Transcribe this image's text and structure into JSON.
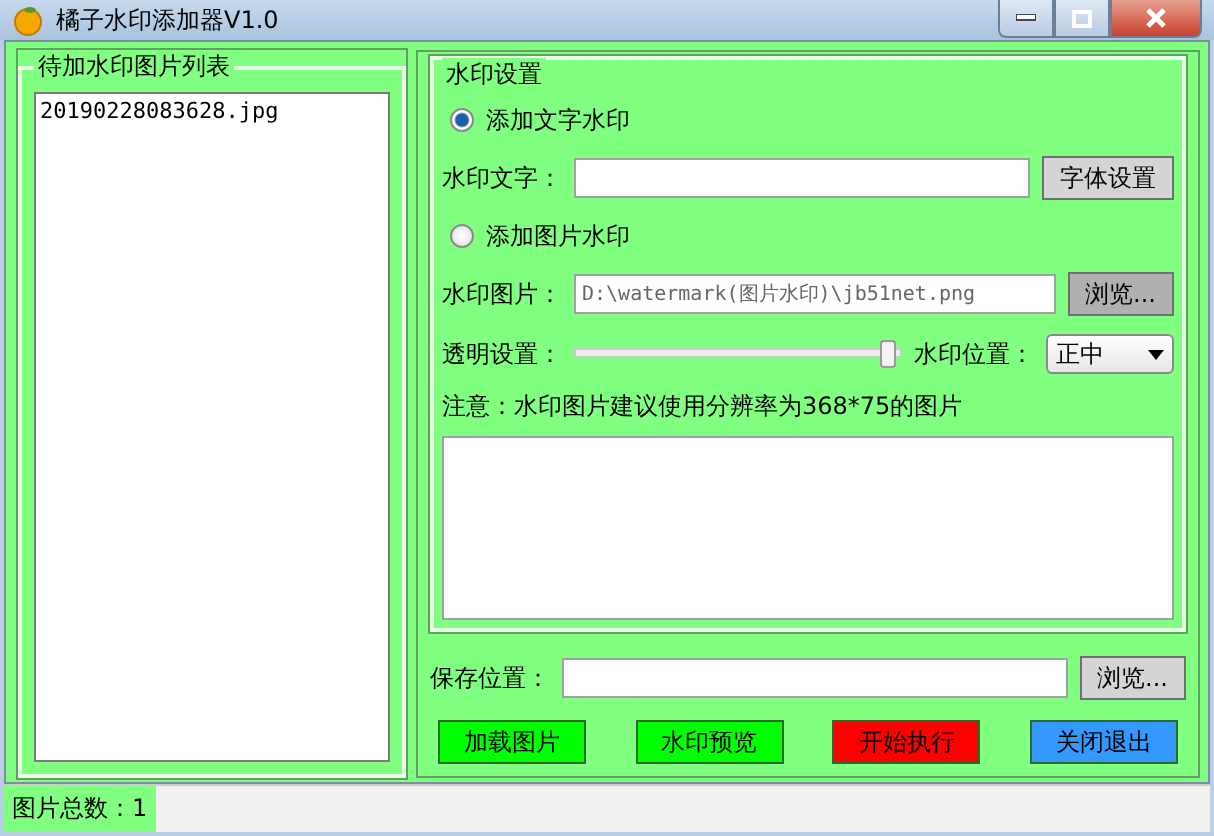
{
  "window": {
    "title": "橘子水印添加器V1.0"
  },
  "file_list": {
    "title": "待加水印图片列表",
    "items": [
      {
        "name": "20190228083628.jpg",
        "selected": false
      }
    ]
  },
  "settings": {
    "title": "水印设置",
    "text_mode": {
      "label": "添加文字水印",
      "selected": true
    },
    "text_label": "水印文字：",
    "font_button": "字体设置",
    "image_mode": {
      "label": "添加图片水印",
      "selected": false
    },
    "image_label": "水印图片：",
    "image_path": "D:\\watermark(图片水印)\\jb51net.png",
    "image_browse": "浏览...",
    "opacity_label": "透明设置：",
    "opacity": {
      "level": 0.98
    },
    "position_label": "水印位置：",
    "position_value": "正中",
    "note": "注意：水印图片建议使用分辨率为368*75的图片"
  },
  "save_label": "保存位置：",
  "save_browse": "浏览...",
  "buttons": [
    {
      "label": "加载图片",
      "color": "#00ff00"
    },
    {
      "label": "水印预览",
      "color": "#00ff00"
    },
    {
      "label": "开始执行",
      "color": "#ff0000"
    },
    {
      "label": "关闭退出",
      "color": "#3399ff"
    }
  ],
  "status_bar": "图片总数：1"
}
